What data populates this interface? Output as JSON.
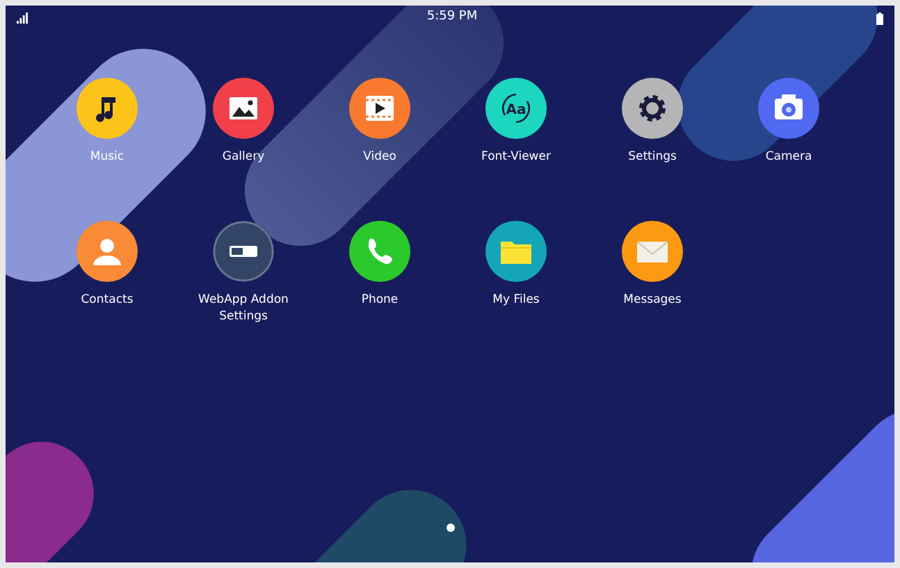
{
  "status_bar": {
    "time": "5:59 PM"
  },
  "apps": [
    {
      "label": "Music",
      "kind": "music",
      "color": "#fcc419"
    },
    {
      "label": "Gallery",
      "kind": "gallery",
      "color": "#f2404a"
    },
    {
      "label": "Video",
      "kind": "video",
      "color": "#f97a2f"
    },
    {
      "label": "Font-Viewer",
      "kind": "font",
      "color": "#1dd6c0",
      "glyph": "Aa"
    },
    {
      "label": "Settings",
      "kind": "gear",
      "color": "#b5b5b8"
    },
    {
      "label": "Camera",
      "kind": "camera",
      "color": "#5168f0"
    },
    {
      "label": "Contacts",
      "kind": "person",
      "color": "#f98a36"
    },
    {
      "label": "WebApp Addon Settings",
      "kind": "toggle",
      "color": "#334566"
    },
    {
      "label": "Phone",
      "kind": "phone",
      "color": "#2cc92c"
    },
    {
      "label": "My Files",
      "kind": "folder",
      "color": "#14a6b8"
    },
    {
      "label": "Messages",
      "kind": "mail",
      "color": "#fb9a10"
    }
  ],
  "pages": [
    {
      "selected": true
    }
  ]
}
